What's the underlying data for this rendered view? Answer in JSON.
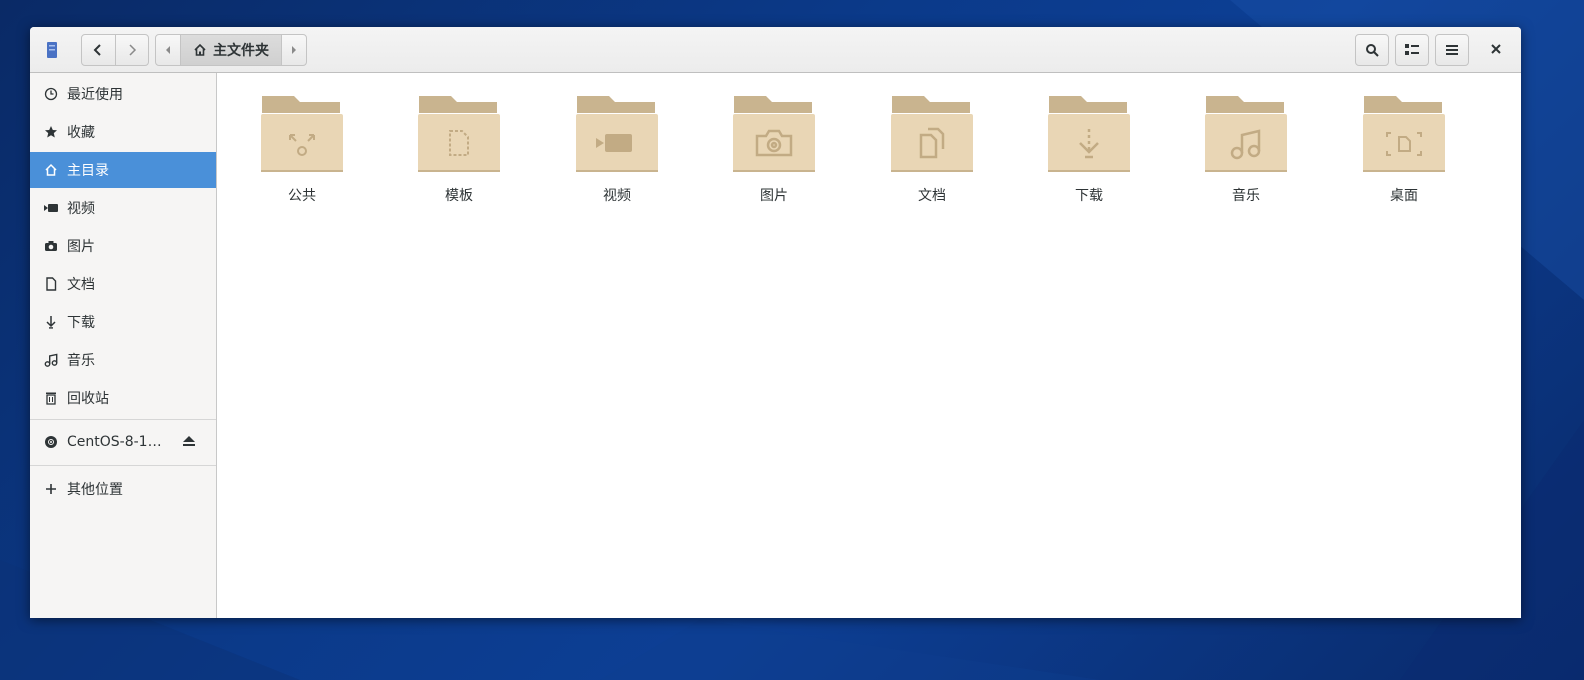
{
  "window": {
    "path_current": "主文件夹"
  },
  "sidebar": {
    "items": [
      {
        "label": "最近使用",
        "icon": "clock-icon"
      },
      {
        "label": "收藏",
        "icon": "star-icon"
      },
      {
        "label": "主目录",
        "icon": "home-icon",
        "active": true
      },
      {
        "label": "视频",
        "icon": "video-icon"
      },
      {
        "label": "图片",
        "icon": "camera-icon"
      },
      {
        "label": "文档",
        "icon": "document-icon"
      },
      {
        "label": "下载",
        "icon": "download-icon"
      },
      {
        "label": "音乐",
        "icon": "music-icon"
      },
      {
        "label": "回收站",
        "icon": "trash-icon"
      }
    ],
    "device": {
      "label": "CentOS-8-1…",
      "icon": "disc-icon"
    },
    "other": {
      "label": "其他位置",
      "icon": "plus-icon"
    }
  },
  "folders": [
    {
      "label": "公共",
      "emblem": "share-icon"
    },
    {
      "label": "模板",
      "emblem": "template-icon"
    },
    {
      "label": "视频",
      "emblem": "video-icon"
    },
    {
      "label": "图片",
      "emblem": "camera-icon"
    },
    {
      "label": "文档",
      "emblem": "documents-icon"
    },
    {
      "label": "下载",
      "emblem": "download-icon"
    },
    {
      "label": "音乐",
      "emblem": "music-icon"
    },
    {
      "label": "桌面",
      "emblem": "desktop-icon"
    }
  ],
  "colors": {
    "accent": "#4a90d9",
    "folder_body": "#e9d6b5",
    "folder_tab": "#c9b48f",
    "emblem": "#c2ab84"
  }
}
